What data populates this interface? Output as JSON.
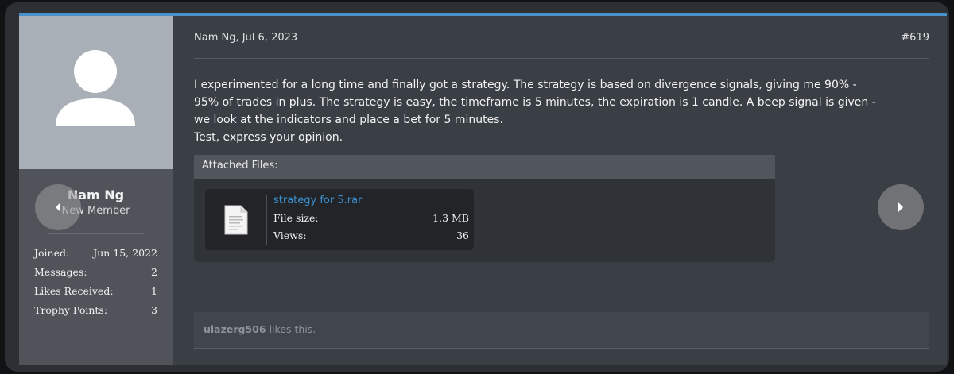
{
  "user": {
    "name": "Nam Ng",
    "title": "New Member",
    "stats": [
      {
        "label": "Joined:",
        "value": "Jun 15, 2022"
      },
      {
        "label": "Messages:",
        "value": "2"
      },
      {
        "label": "Likes Received:",
        "value": "1"
      },
      {
        "label": "Trophy Points:",
        "value": "3"
      }
    ]
  },
  "post": {
    "author_date": "Nam Ng, Jul 6, 2023",
    "number": "#619",
    "body_lines": [
      "I experimented for a long time and finally got a strategy. The strategy is based on divergence signals, giving me 90% -",
      "95% of trades in plus. The strategy is easy, the timeframe is 5 minutes, the expiration is 1 candle. A beep signal is given -",
      "we look at the indicators and place a bet for 5 minutes.",
      "Test, express your opinion."
    ]
  },
  "attachments": {
    "title": "Attached Files:",
    "files": [
      {
        "name": "strategy for 5.rar",
        "size_label": "File size:",
        "size": "1.3 MB",
        "views_label": "Views:",
        "views": "36"
      }
    ]
  },
  "likes": {
    "user": "ulazerg506",
    "text": "likes this."
  },
  "icons": {
    "avatar": "default-avatar-icon",
    "file": "file-icon",
    "prev": "chevron-left-icon",
    "next": "chevron-right-icon"
  },
  "colors": {
    "accent": "#4a90c8",
    "link": "#3c8fd0"
  }
}
